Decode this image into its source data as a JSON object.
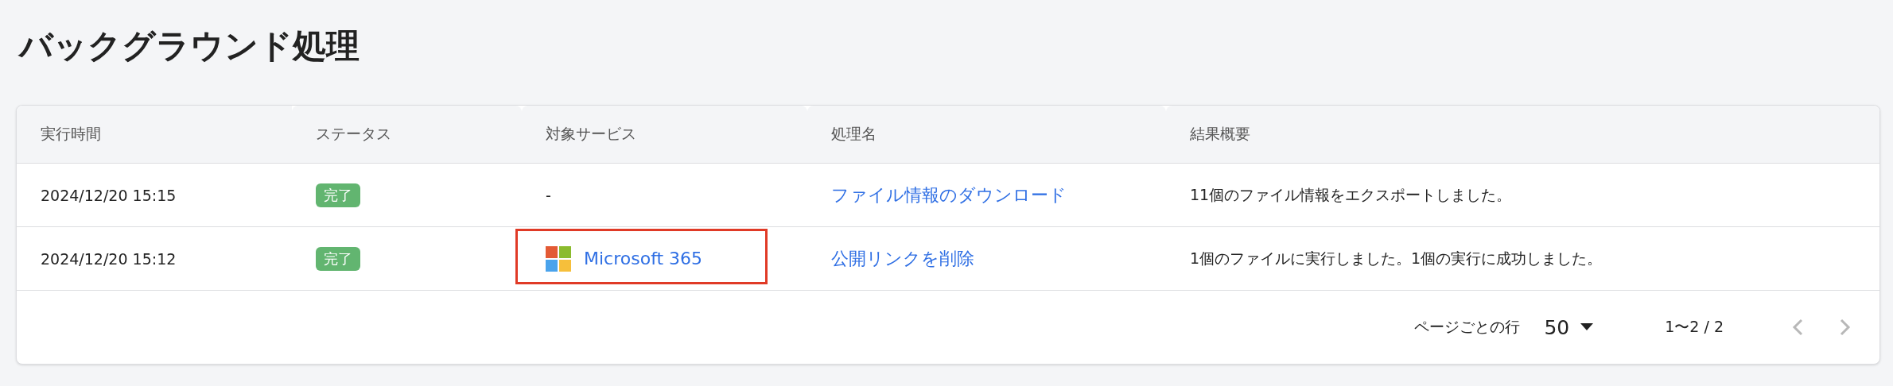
{
  "page": {
    "title": "バックグラウンド処理"
  },
  "table": {
    "columns": [
      "実行時間",
      "ステータス",
      "対象サービス",
      "処理名",
      "結果概要"
    ],
    "rows": [
      {
        "time": "2024/12/20 15:15",
        "status": "完了",
        "service": {
          "kind": "none",
          "label": "-"
        },
        "process": "ファイル情報のダウンロード",
        "summary": "11個のファイル情報をエクスポートしました。",
        "highlighted": false
      },
      {
        "time": "2024/12/20 15:12",
        "status": "完了",
        "service": {
          "kind": "microsoft",
          "label": "Microsoft 365"
        },
        "process": "公開リンクを削除",
        "summary": "1個のファイルに実行しました。1個の実行に成功しました。",
        "highlighted": true
      }
    ]
  },
  "pagination": {
    "rows_per_page_label": "ページごとの行",
    "rows_per_page": "50",
    "range": "1〜2 / 2",
    "prev_disabled": true,
    "next_disabled": true
  }
}
